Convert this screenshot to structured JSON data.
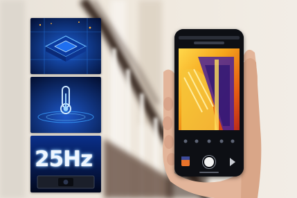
{
  "frame_rate_label": "25Hz",
  "icons": {
    "chip": "processor-chip-icon",
    "thermometer": "thermometer-icon",
    "camera": "thermal-camera-module-icon",
    "shutter": "shutter-button-icon"
  },
  "colors": {
    "tile_background": "#06205a",
    "tile_glow": "#2f8cff",
    "thermal_hot": "#ffd21a",
    "thermal_warm": "#e85a10",
    "thermal_cold": "#3a1c8c",
    "wall": "#ece4d8"
  }
}
